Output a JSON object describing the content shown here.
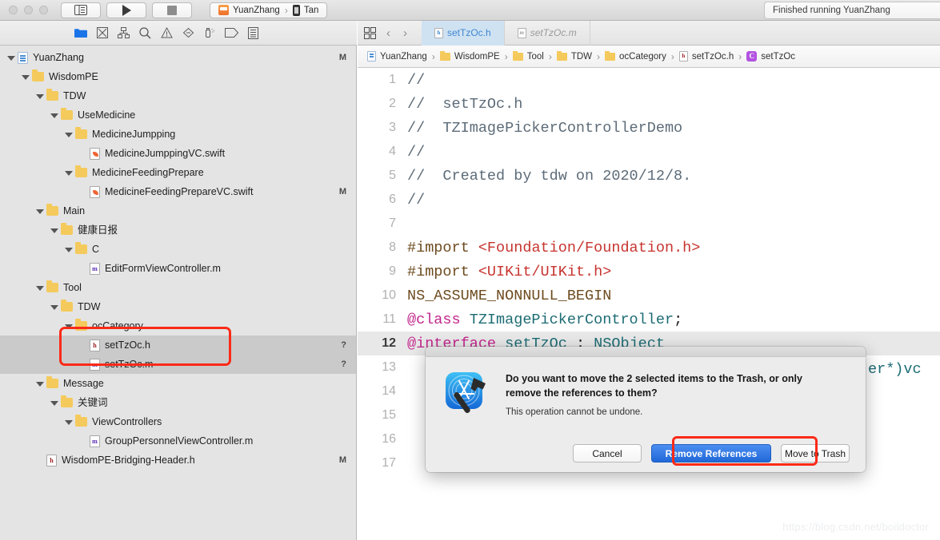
{
  "titlebar": {
    "scheme_app": "YuanZhang",
    "scheme_sep": "›",
    "scheme_device": "Tan",
    "status_text": "Finished running YuanZhang",
    "buttons": [
      {
        "name": "toggle-panels-button",
        "label": ""
      },
      {
        "name": "run-button",
        "label": ""
      },
      {
        "name": "stop-button",
        "label": ""
      }
    ]
  },
  "navigator_toolbar": {
    "icons": [
      {
        "name": "project-navigator-icon",
        "label": "folder"
      },
      {
        "name": "source-control-navigator-icon",
        "label": "source-control"
      },
      {
        "name": "symbol-navigator-icon",
        "label": "symbol"
      },
      {
        "name": "find-navigator-icon",
        "label": "search"
      },
      {
        "name": "issue-navigator-icon",
        "label": "warning"
      },
      {
        "name": "test-navigator-icon",
        "label": "diamond"
      },
      {
        "name": "debug-navigator-icon",
        "label": "debug"
      },
      {
        "name": "breakpoint-navigator-icon",
        "label": "tag"
      },
      {
        "name": "report-navigator-icon",
        "label": "report"
      }
    ]
  },
  "sidebar": {
    "rows": [
      {
        "indent": 0,
        "twisty": true,
        "icon": "proj",
        "label": "YuanZhang",
        "badge": "M",
        "selected": false
      },
      {
        "indent": 1,
        "twisty": true,
        "icon": "folder",
        "label": "WisdomPE",
        "badge": "",
        "selected": false
      },
      {
        "indent": 2,
        "twisty": true,
        "icon": "folder",
        "label": "TDW",
        "badge": "",
        "selected": false
      },
      {
        "indent": 3,
        "twisty": true,
        "icon": "folder",
        "label": "UseMedicine",
        "badge": "",
        "selected": false
      },
      {
        "indent": 4,
        "twisty": true,
        "icon": "folder",
        "label": "MedicineJumpping",
        "badge": "",
        "selected": false
      },
      {
        "indent": 5,
        "twisty": false,
        "icon": "swift",
        "label": "MedicineJumppingVC.swift",
        "badge": "",
        "selected": false
      },
      {
        "indent": 4,
        "twisty": true,
        "icon": "folder",
        "label": "MedicineFeedingPrepare",
        "badge": "",
        "selected": false
      },
      {
        "indent": 5,
        "twisty": false,
        "icon": "swift",
        "label": "MedicineFeedingPrepareVC.swift",
        "badge": "M",
        "selected": false
      },
      {
        "indent": 2,
        "twisty": true,
        "icon": "folder",
        "label": "Main",
        "badge": "",
        "selected": false
      },
      {
        "indent": 3,
        "twisty": true,
        "icon": "folder",
        "label": "健康日报",
        "badge": "",
        "selected": false
      },
      {
        "indent": 4,
        "twisty": true,
        "icon": "folder",
        "label": "C",
        "badge": "",
        "selected": false
      },
      {
        "indent": 5,
        "twisty": false,
        "icon": "m",
        "label": "EditFormViewController.m",
        "badge": "",
        "selected": false
      },
      {
        "indent": 2,
        "twisty": true,
        "icon": "folder",
        "label": "Tool",
        "badge": "",
        "selected": false
      },
      {
        "indent": 3,
        "twisty": true,
        "icon": "folder",
        "label": "TDW",
        "badge": "",
        "selected": false
      },
      {
        "indent": 4,
        "twisty": true,
        "icon": "folder",
        "label": "ocCategory",
        "badge": "",
        "selected": false
      },
      {
        "indent": 5,
        "twisty": false,
        "icon": "h",
        "label": "setTzOc.h",
        "badge": "?",
        "selected": true
      },
      {
        "indent": 5,
        "twisty": false,
        "icon": "m",
        "label": "setTzOc.m",
        "badge": "?",
        "selected": true
      },
      {
        "indent": 2,
        "twisty": true,
        "icon": "folder",
        "label": "Message",
        "badge": "",
        "selected": false
      },
      {
        "indent": 3,
        "twisty": true,
        "icon": "folder",
        "label": "关键词",
        "badge": "",
        "selected": false
      },
      {
        "indent": 4,
        "twisty": true,
        "icon": "folder",
        "label": "ViewControllers",
        "badge": "",
        "selected": false
      },
      {
        "indent": 5,
        "twisty": false,
        "icon": "m",
        "label": "GroupPersonnelViewController.m",
        "badge": "",
        "selected": false
      },
      {
        "indent": 2,
        "twisty": false,
        "icon": "h",
        "label": "WisdomPE-Bridging-Header.h",
        "badge": "M",
        "selected": false
      }
    ],
    "highlight_color": "#fb2a18"
  },
  "editor": {
    "tabs": [
      {
        "label": "setTzOc.h",
        "kind": "h",
        "active": true
      },
      {
        "label": "setTzOc.m",
        "kind": "m",
        "active": false
      }
    ],
    "breadcrumb": [
      {
        "icon": "project",
        "label": "YuanZhang"
      },
      {
        "icon": "folder",
        "label": "WisdomPE"
      },
      {
        "icon": "folder",
        "label": "Tool"
      },
      {
        "icon": "folder",
        "label": "TDW"
      },
      {
        "icon": "folder",
        "label": "ocCategory"
      },
      {
        "icon": "file-h",
        "label": "setTzOc.h"
      },
      {
        "icon": "class-c",
        "label": "setTzOc"
      }
    ],
    "breadcrumb_separator": "›",
    "lines": [
      {
        "num": "1",
        "highlight": false,
        "tokens": [
          {
            "t": "//",
            "c": "com"
          }
        ]
      },
      {
        "num": "2",
        "highlight": false,
        "tokens": [
          {
            "t": "//  setTzOc.h",
            "c": "com"
          }
        ]
      },
      {
        "num": "3",
        "highlight": false,
        "tokens": [
          {
            "t": "//  TZImagePickerControllerDemo",
            "c": "com"
          }
        ]
      },
      {
        "num": "4",
        "highlight": false,
        "tokens": [
          {
            "t": "//",
            "c": "com"
          }
        ]
      },
      {
        "num": "5",
        "highlight": false,
        "tokens": [
          {
            "t": "//  Created by tdw on 2020/12/8.",
            "c": "com"
          }
        ]
      },
      {
        "num": "6",
        "highlight": false,
        "tokens": [
          {
            "t": "//",
            "c": "com"
          }
        ]
      },
      {
        "num": "7",
        "highlight": false,
        "tokens": []
      },
      {
        "num": "8",
        "highlight": false,
        "tokens": [
          {
            "t": "#import ",
            "c": "pre"
          },
          {
            "t": "<Foundation/Foundation.h>",
            "c": "str"
          }
        ]
      },
      {
        "num": "9",
        "highlight": false,
        "tokens": [
          {
            "t": "#import ",
            "c": "pre"
          },
          {
            "t": "<UIKit/UIKit.h>",
            "c": "str"
          }
        ]
      },
      {
        "num": "10",
        "highlight": false,
        "tokens": [
          {
            "t": "NS_ASSUME_NONNULL_BEGIN",
            "c": "mac"
          }
        ]
      },
      {
        "num": "11",
        "highlight": false,
        "tokens": [
          {
            "t": "@class ",
            "c": "kw"
          },
          {
            "t": "TZImagePickerController",
            "c": "typ"
          },
          {
            "t": ";",
            "c": "pln"
          }
        ]
      },
      {
        "num": "12",
        "highlight": true,
        "tokens": [
          {
            "t": "@interface ",
            "c": "kw"
          },
          {
            "t": "setTzOc ",
            "c": "typ"
          },
          {
            "t": ": ",
            "c": "pln"
          },
          {
            "t": "NSObject",
            "c": "typ"
          }
        ]
      },
      {
        "num": "13",
        "highlight": false,
        "tokens": []
      },
      {
        "num": "14",
        "highlight": false,
        "tokens": []
      },
      {
        "num": "15",
        "highlight": false,
        "tokens": []
      },
      {
        "num": "16",
        "highlight": false,
        "tokens": []
      },
      {
        "num": "17",
        "highlight": false,
        "tokens": []
      }
    ],
    "partial_code_right": "er*)vc",
    "watermark": "https://blog.csdn.net/boildoctor"
  },
  "dialog": {
    "title": "Do you want to move the 2 selected items to the Trash, or only remove the references to them?",
    "subtitle": "This operation cannot be undone.",
    "buttons": [
      {
        "name": "cancel-button",
        "label": "Cancel",
        "primary": false,
        "highlighted": false
      },
      {
        "name": "remove-references-button",
        "label": "Remove References",
        "primary": true,
        "highlighted": true
      },
      {
        "name": "move-to-trash-button",
        "label": "Move to Trash",
        "primary": false,
        "highlighted": false
      }
    ],
    "app_icon": "xcode-hammer-icon",
    "highlight_color": "#fb2a18"
  }
}
